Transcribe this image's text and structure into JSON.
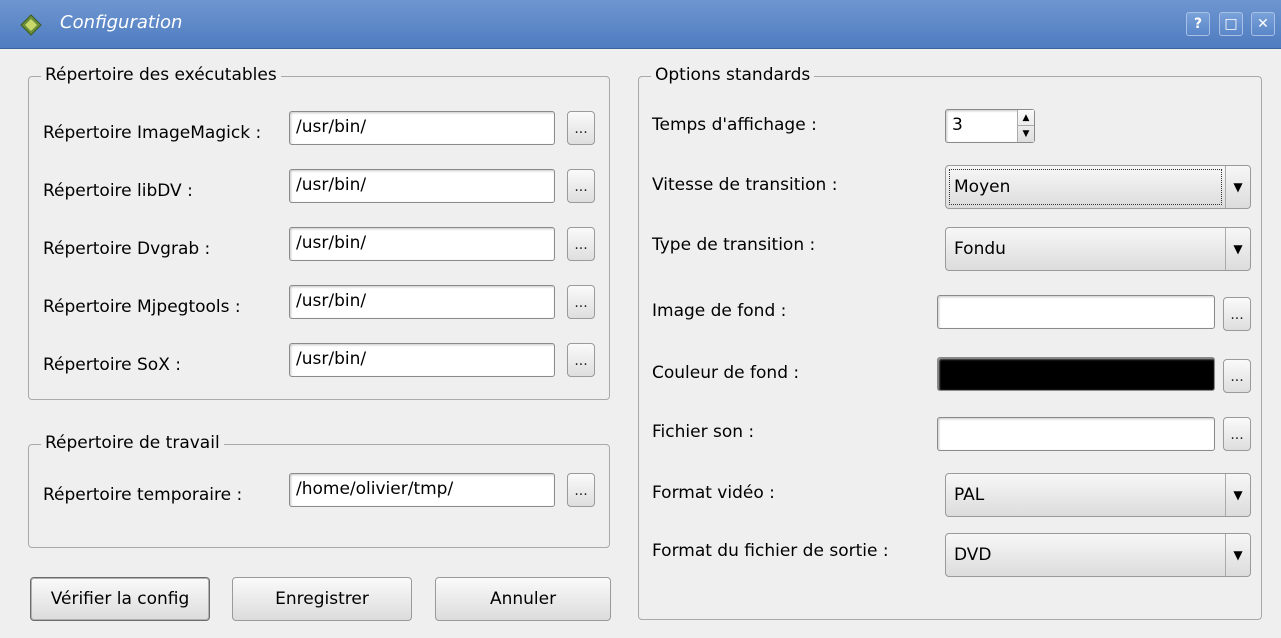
{
  "window": {
    "title": "Configuration",
    "buttons": {
      "help": "?",
      "maximize": "□",
      "close": "✕"
    }
  },
  "executables_group": {
    "title": "Répertoire des exécutables",
    "rows": [
      {
        "label": "Répertoire ImageMagick :",
        "value": "/usr/bin/",
        "browse": "..."
      },
      {
        "label": "Répertoire libDV :",
        "value": "/usr/bin/",
        "browse": "..."
      },
      {
        "label": "Répertoire Dvgrab :",
        "value": "/usr/bin/",
        "browse": "..."
      },
      {
        "label": "Répertoire Mjpegtools :",
        "value": "/usr/bin/",
        "browse": "..."
      },
      {
        "label": "Répertoire SoX :",
        "value": "/usr/bin/",
        "browse": "..."
      }
    ]
  },
  "work_group": {
    "title": "Répertoire de travail",
    "temp_label": "Répertoire temporaire :",
    "temp_value": "/home/olivier/tmp/",
    "browse": "..."
  },
  "buttons": {
    "check": "Vérifier la config",
    "save": "Enregistrer",
    "cancel": "Annuler"
  },
  "options_group": {
    "title": "Options standards",
    "display_time_label": "Temps d'affichage :",
    "display_time_value": "3",
    "transition_speed_label": "Vitesse de transition :",
    "transition_speed_value": "Moyen",
    "transition_type_label": "Type de transition :",
    "transition_type_value": "Fondu",
    "background_image_label": "Image de fond :",
    "background_image_value": "",
    "background_color_label": "Couleur de fond :",
    "background_color_value": "#000000",
    "sound_file_label": "Fichier son :",
    "sound_file_value": "",
    "video_format_label": "Format vidéo :",
    "video_format_value": "PAL",
    "output_format_label": "Format du fichier de sortie :",
    "output_format_value": "DVD",
    "browse": "..."
  },
  "colors": {
    "titlebar": "#5a86c8",
    "background": "#efefef"
  }
}
